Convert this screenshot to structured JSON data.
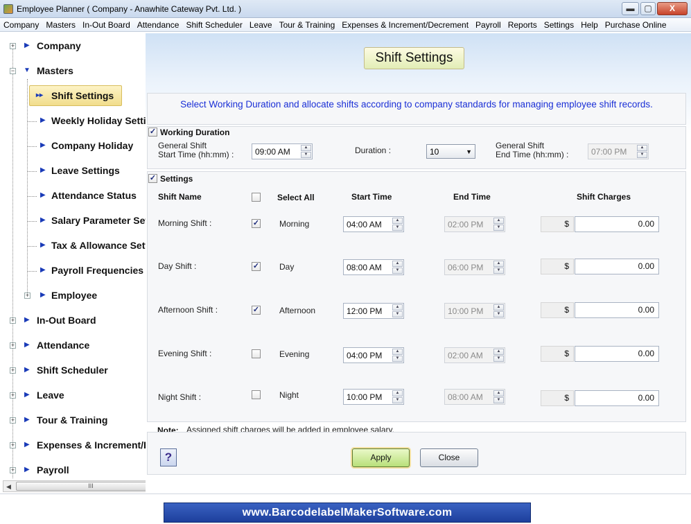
{
  "window": {
    "title": "Employee Planner ( Company - Anawhite Cateway Pvt. Ltd. )",
    "minimize": "▬",
    "maximize": "▢",
    "close": "X"
  },
  "menu": [
    "Company",
    "Masters",
    "In-Out Board",
    "Attendance",
    "Shift Scheduler",
    "Leave",
    "Tour & Training",
    "Expenses & Increment/Decrement",
    "Payroll",
    "Reports",
    "Settings",
    "Help",
    "Purchase Online"
  ],
  "sidebar": {
    "nodes": [
      {
        "label": "Company",
        "expander": "+",
        "arrow": "▶"
      },
      {
        "label": "Masters",
        "expander": "−",
        "arrow": "▼"
      },
      {
        "label": "Shift Settings",
        "selected": true,
        "arrow": "▸▸"
      },
      {
        "label": "Weekly Holiday Settings",
        "arrow": "▶"
      },
      {
        "label": "Company Holiday",
        "arrow": "▶"
      },
      {
        "label": "Leave Settings",
        "arrow": "▶"
      },
      {
        "label": "Attendance Status",
        "arrow": "▶"
      },
      {
        "label": "Salary Parameter Settings",
        "arrow": "▶"
      },
      {
        "label": "Tax & Allowance Settings",
        "arrow": "▶"
      },
      {
        "label": "Payroll Frequencies",
        "arrow": "▶"
      },
      {
        "label": "Employee",
        "expander": "+",
        "arrow": "▶"
      },
      {
        "label": "In-Out Board",
        "expander": "+",
        "arrow": "▶"
      },
      {
        "label": "Attendance",
        "expander": "+",
        "arrow": "▶"
      },
      {
        "label": "Shift Scheduler",
        "expander": "+",
        "arrow": "▶"
      },
      {
        "label": "Leave",
        "expander": "+",
        "arrow": "▶"
      },
      {
        "label": "Tour & Training",
        "expander": "+",
        "arrow": "▶"
      },
      {
        "label": "Expenses & Increment/Decrement",
        "expander": "+",
        "arrow": "▶"
      },
      {
        "label": "Payroll",
        "expander": "+",
        "arrow": "▶"
      }
    ],
    "scroll_left": "◀",
    "scroll_right": "▶",
    "scroll_thumb": "III"
  },
  "main": {
    "page_title": "Shift Settings",
    "description": "Select Working Duration and allocate shifts according to company standards for managing employee shift records.",
    "working_duration": {
      "heading": "Working Duration",
      "checked_mark": "✓",
      "start_label_line1": "General Shift",
      "start_label_line2": "Start Time (hh:mm) :",
      "start_value": "09:00 AM",
      "duration_label": "Duration :",
      "duration_value": "10",
      "end_label_line1": "General Shift",
      "end_label_line2": "End Time (hh:mm) :",
      "end_value": "07:00 PM"
    },
    "settings": {
      "heading": "Settings",
      "checked_mark": "✓",
      "columns": {
        "shift_name": "Shift Name",
        "select_all": "Select All",
        "start_time": "Start Time",
        "end_time": "End Time",
        "shift_charges": "Shift Charges"
      },
      "rows": [
        {
          "name": "Morning Shift :",
          "checked": "✓",
          "label": "Morning",
          "start": "04:00 AM",
          "end": "02:00 PM",
          "currency": "$",
          "charge": "0.00"
        },
        {
          "name": "Day Shift :",
          "checked": "✓",
          "label": "Day",
          "start": "08:00 AM",
          "end": "06:00 PM",
          "currency": "$",
          "charge": "0.00"
        },
        {
          "name": "Afternoon Shift :",
          "checked": "✓",
          "label": "Afternoon",
          "start": "12:00 PM",
          "end": "10:00 PM",
          "currency": "$",
          "charge": "0.00"
        },
        {
          "name": "Evening Shift :",
          "checked": "",
          "label": "Evening",
          "start": "04:00 PM",
          "end": "02:00 AM",
          "currency": "$",
          "charge": "0.00"
        },
        {
          "name": "Night Shift :",
          "checked": "",
          "label": "Night",
          "start": "10:00 PM",
          "end": "08:00 AM",
          "currency": "$",
          "charge": "0.00"
        }
      ]
    },
    "note_label": "Note:",
    "note_text": "Assigned shift charges will be added in employee salary.",
    "help_glyph": "?",
    "apply_label": "Apply",
    "close_label": "Close"
  },
  "footer": {
    "text": "www.BarcodelabelMakerSoftware.com"
  }
}
